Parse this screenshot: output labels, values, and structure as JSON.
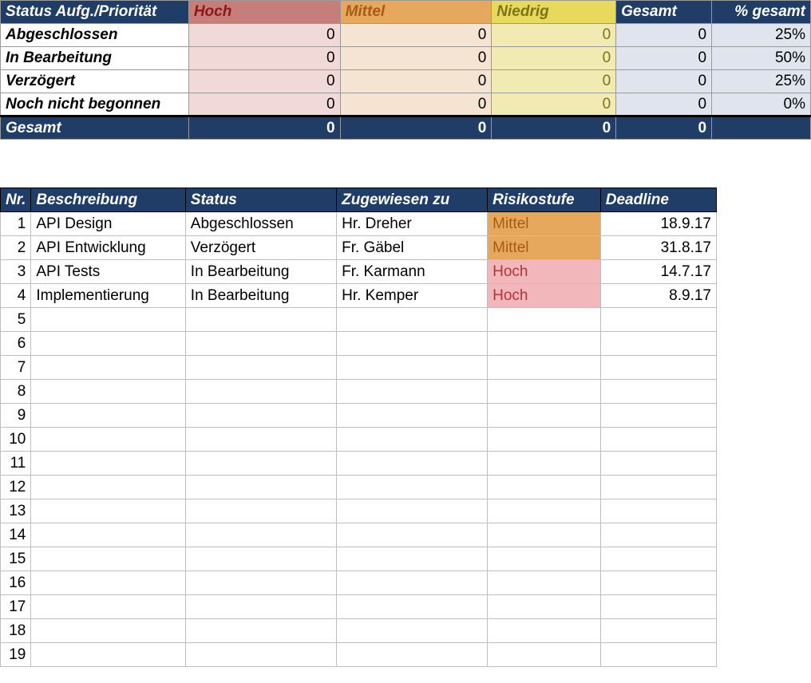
{
  "summary": {
    "header": {
      "status_label": "Status Aufg./Priorität",
      "hoch": "Hoch",
      "mittel": "Mittel",
      "niedrig": "Niedrig",
      "gesamt": "Gesamt",
      "pct_gesamt": "% gesamt"
    },
    "rows": [
      {
        "label": "Abgeschlossen",
        "hoch": "0",
        "mittel": "0",
        "niedrig": "0",
        "gesamt": "0",
        "pct": "25%"
      },
      {
        "label": "In Bearbeitung",
        "hoch": "0",
        "mittel": "0",
        "niedrig": "0",
        "gesamt": "0",
        "pct": "50%"
      },
      {
        "label": "Verzögert",
        "hoch": "0",
        "mittel": "0",
        "niedrig": "0",
        "gesamt": "0",
        "pct": "25%"
      },
      {
        "label": "Noch nicht begonnen",
        "hoch": "0",
        "mittel": "0",
        "niedrig": "0",
        "gesamt": "0",
        "pct": "0%"
      }
    ],
    "totals": {
      "label": "Gesamt",
      "hoch": "0",
      "mittel": "0",
      "niedrig": "0",
      "gesamt": "0",
      "pct": ""
    }
  },
  "tasks": {
    "header": {
      "nr": "Nr.",
      "beschreibung": "Beschreibung",
      "status": "Status",
      "zugewiesen": "Zugewiesen zu",
      "risikostufe": "Risikostufe",
      "deadline": "Deadline"
    },
    "rows": [
      {
        "nr": "1",
        "beschreibung": "API Design",
        "status": "Abgeschlossen",
        "zugewiesen": "Hr. Dreher",
        "risikostufe": "Mittel",
        "risk_class": "risk-mittel",
        "deadline": "18.9.17"
      },
      {
        "nr": "2",
        "beschreibung": "API Entwicklung",
        "status": "Verzögert",
        "zugewiesen": "Fr. Gäbel",
        "risikostufe": "Mittel",
        "risk_class": "risk-mittel",
        "deadline": "31.8.17"
      },
      {
        "nr": "3",
        "beschreibung": "API Tests",
        "status": "In Bearbeitung",
        "zugewiesen": "Fr. Karmann",
        "risikostufe": "Hoch",
        "risk_class": "risk-hoch",
        "deadline": "14.7.17"
      },
      {
        "nr": "4",
        "beschreibung": "Implementierung",
        "status": "In Bearbeitung",
        "zugewiesen": "Hr. Kemper",
        "risikostufe": "Hoch",
        "risk_class": "risk-hoch",
        "deadline": "8.9.17"
      },
      {
        "nr": "5",
        "beschreibung": "",
        "status": "",
        "zugewiesen": "",
        "risikostufe": "",
        "risk_class": "",
        "deadline": ""
      },
      {
        "nr": "6",
        "beschreibung": "",
        "status": "",
        "zugewiesen": "",
        "risikostufe": "",
        "risk_class": "",
        "deadline": ""
      },
      {
        "nr": "7",
        "beschreibung": "",
        "status": "",
        "zugewiesen": "",
        "risikostufe": "",
        "risk_class": "",
        "deadline": ""
      },
      {
        "nr": "8",
        "beschreibung": "",
        "status": "",
        "zugewiesen": "",
        "risikostufe": "",
        "risk_class": "",
        "deadline": ""
      },
      {
        "nr": "9",
        "beschreibung": "",
        "status": "",
        "zugewiesen": "",
        "risikostufe": "",
        "risk_class": "",
        "deadline": ""
      },
      {
        "nr": "10",
        "beschreibung": "",
        "status": "",
        "zugewiesen": "",
        "risikostufe": "",
        "risk_class": "",
        "deadline": ""
      },
      {
        "nr": "11",
        "beschreibung": "",
        "status": "",
        "zugewiesen": "",
        "risikostufe": "",
        "risk_class": "",
        "deadline": ""
      },
      {
        "nr": "12",
        "beschreibung": "",
        "status": "",
        "zugewiesen": "",
        "risikostufe": "",
        "risk_class": "",
        "deadline": ""
      },
      {
        "nr": "13",
        "beschreibung": "",
        "status": "",
        "zugewiesen": "",
        "risikostufe": "",
        "risk_class": "",
        "deadline": ""
      },
      {
        "nr": "14",
        "beschreibung": "",
        "status": "",
        "zugewiesen": "",
        "risikostufe": "",
        "risk_class": "",
        "deadline": ""
      },
      {
        "nr": "15",
        "beschreibung": "",
        "status": "",
        "zugewiesen": "",
        "risikostufe": "",
        "risk_class": "",
        "deadline": ""
      },
      {
        "nr": "16",
        "beschreibung": "",
        "status": "",
        "zugewiesen": "",
        "risikostufe": "",
        "risk_class": "",
        "deadline": ""
      },
      {
        "nr": "17",
        "beschreibung": "",
        "status": "",
        "zugewiesen": "",
        "risikostufe": "",
        "risk_class": "",
        "deadline": ""
      },
      {
        "nr": "18",
        "beschreibung": "",
        "status": "",
        "zugewiesen": "",
        "risikostufe": "",
        "risk_class": "",
        "deadline": ""
      },
      {
        "nr": "19",
        "beschreibung": "",
        "status": "",
        "zugewiesen": "",
        "risikostufe": "",
        "risk_class": "",
        "deadline": ""
      }
    ]
  }
}
